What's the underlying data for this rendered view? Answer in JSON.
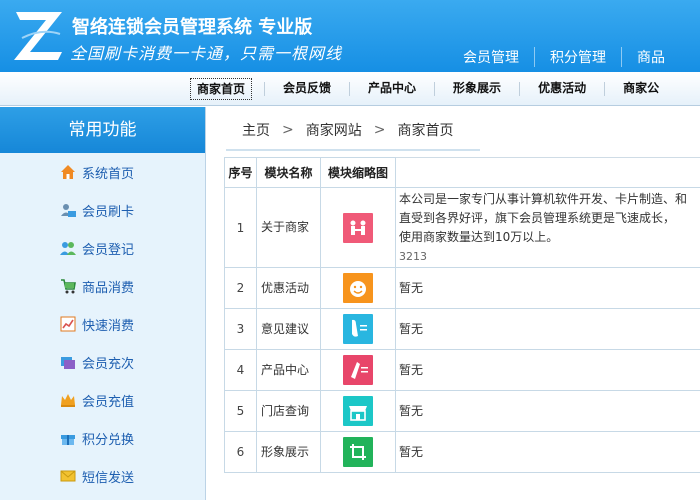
{
  "header": {
    "title": "智络连锁会员管理系统 专业版",
    "slogan": "全国刷卡消费一卡通，只需一根网线",
    "top_nav": [
      "会员管理",
      "积分管理",
      "商品"
    ]
  },
  "second_nav": {
    "items": [
      "商家首页",
      "会员反馈",
      "产品中心",
      "形象展示",
      "优惠活动",
      "商家公"
    ],
    "active_index": 0
  },
  "sidebar": {
    "title": "常用功能",
    "items": [
      {
        "label": "系统首页",
        "icon": "home-icon"
      },
      {
        "label": "会员刷卡",
        "icon": "member-card-icon"
      },
      {
        "label": "会员登记",
        "icon": "register-users-icon"
      },
      {
        "label": "商品消费",
        "icon": "cart-icon"
      },
      {
        "label": "快速消费",
        "icon": "chart-icon"
      },
      {
        "label": "会员充次",
        "icon": "recharge-count-icon"
      },
      {
        "label": "会员充值",
        "icon": "crown-icon"
      },
      {
        "label": "积分兑换",
        "icon": "gift-icon"
      },
      {
        "label": "短信发送",
        "icon": "envelope-icon"
      }
    ]
  },
  "breadcrumb": [
    "主页",
    "商家网站",
    "商家首页"
  ],
  "table": {
    "headers": [
      "序号",
      "模块名称",
      "模块缩略图",
      ""
    ],
    "rows": [
      {
        "no": "1",
        "name": "关于商家",
        "thumb_color": "#f05a78",
        "thumb_icon": "about-icon",
        "desc_lines": [
          "本公司是一家专门从事计算机软件开发、卡片制造、和",
          "直受到各界好评，旗下会员管理系统更是飞速成长，",
          "使用商家数量达到10万以上。"
        ],
        "desc_id": "3213"
      },
      {
        "no": "2",
        "name": "优惠活动",
        "thumb_color": "#f7941d",
        "thumb_icon": "smile-icon",
        "desc_lines": [
          "暂无"
        ],
        "desc_id": ""
      },
      {
        "no": "3",
        "name": "意见建议",
        "thumb_color": "#29b6e0",
        "thumb_icon": "feedback-icon",
        "desc_lines": [
          "暂无"
        ],
        "desc_id": ""
      },
      {
        "no": "4",
        "name": "产品中心",
        "thumb_color": "#e8466a",
        "thumb_icon": "product-icon",
        "desc_lines": [
          "暂无"
        ],
        "desc_id": ""
      },
      {
        "no": "5",
        "name": "门店查询",
        "thumb_color": "#1cc7c7",
        "thumb_icon": "store-icon",
        "desc_lines": [
          "暂无"
        ],
        "desc_id": ""
      },
      {
        "no": "6",
        "name": "形象展示",
        "thumb_color": "#22b35a",
        "thumb_icon": "crop-icon",
        "desc_lines": [
          "暂无"
        ],
        "desc_id": ""
      }
    ]
  },
  "colors": {
    "header_blue": "#1d94e8",
    "sidebar_bg": "#e6f3fc",
    "sidebar_text": "#1e5fb0"
  }
}
